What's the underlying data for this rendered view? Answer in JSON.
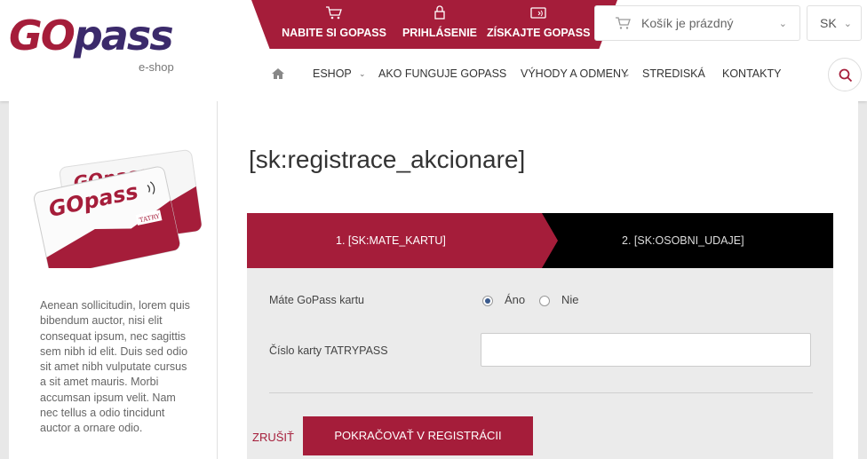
{
  "logo": {
    "go": "GO",
    "pass": "pass",
    "sub": "e-shop"
  },
  "topbar": [
    {
      "label": "NABITE SI GOPASS",
      "icon": "cart-icon"
    },
    {
      "label": "PRIHLÁSENIE",
      "icon": "lock-icon"
    },
    {
      "label": "ZÍSKAJTE GOPASS",
      "icon": "card-icon"
    }
  ],
  "cart": {
    "label": "Košík je prázdný"
  },
  "lang": {
    "label": "SK"
  },
  "nav": {
    "items": [
      "ESHOP",
      "AKO FUNGUJE GOPASS",
      "VÝHODY A ODMENY",
      "STREDISKÁ",
      "KONTAKTY"
    ]
  },
  "sidebar": {
    "card_logo": "GOpass",
    "card_logo_back": "GOpass",
    "card_brand": "TATRY",
    "text": "Aenean sollicitudin, lorem quis bibendum auctor, nisi elit consequat ipsum, nec sagittis sem nibh id elit. Duis sed odio sit amet nibh vulputate cursus a sit amet mauris. Morbi accumsan ipsum velit. Nam nec tellus a odio tincidunt auctor a ornare odio."
  },
  "main": {
    "title": "[sk:registrace_akcionare]",
    "steps": [
      "1. [SK:MATE_KARTU]",
      "2. [SK:OSOBNI_UDAJE]"
    ],
    "form": {
      "has_card_label": "Máte GoPass kartu",
      "yes": "Áno",
      "no": "Nie",
      "card_number_label": "Číslo karty TATRYPASS",
      "card_number_value": "",
      "cancel": "ZRUŠIŤ",
      "continue": "POKRAČOVAŤ V REGISTRÁCII"
    }
  },
  "colors": {
    "brand": "#a51d3a",
    "brand_dark": "#3b2a6b"
  }
}
